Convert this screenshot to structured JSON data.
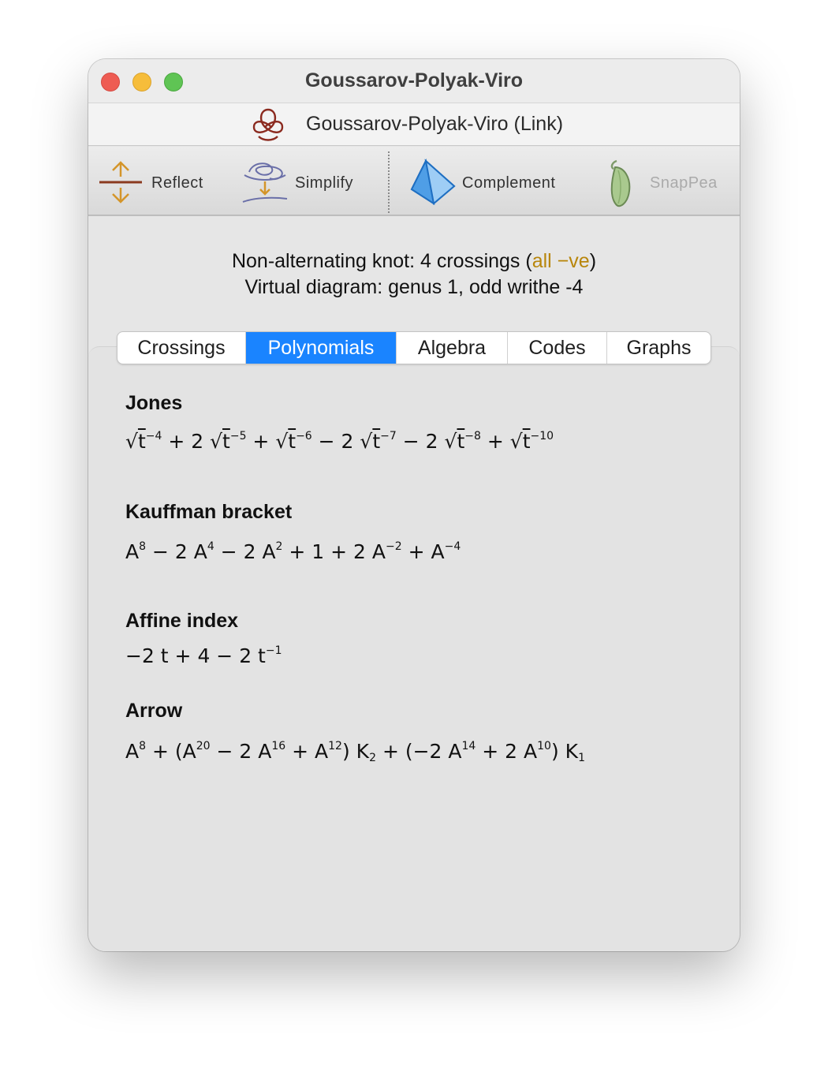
{
  "window": {
    "title": "Goussarov-Polyak-Viro",
    "document_title": "Goussarov-Polyak-Viro (Link)"
  },
  "toolbar": {
    "reflect_label": "Reflect",
    "simplify_label": "Simplify",
    "complement_label": "Complement",
    "snappea_label": "SnapPea"
  },
  "summary": {
    "line1_prefix": "Non-alternating knot: 4 crossings (",
    "line1_highlight": "all −ve",
    "line1_suffix": ")",
    "line2": "Virtual diagram: genus 1, odd writhe -4",
    "highlight_color": "#b8860b"
  },
  "tabs": [
    {
      "label": "Crossings",
      "active": false
    },
    {
      "label": "Polynomials",
      "active": true
    },
    {
      "label": "Algebra",
      "active": false
    },
    {
      "label": "Codes",
      "active": false
    },
    {
      "label": "Graphs",
      "active": false
    }
  ],
  "accent_color": "#1a84ff",
  "polynomials": {
    "jones": {
      "title": "Jones",
      "terms": [
        {
          "coef": "",
          "sign": "",
          "exp": "−4"
        },
        {
          "coef": "2",
          "sign": "+",
          "exp": "−5"
        },
        {
          "coef": "",
          "sign": "+",
          "exp": "−6"
        },
        {
          "coef": "2",
          "sign": "−",
          "exp": "−7"
        },
        {
          "coef": "2",
          "sign": "−",
          "exp": "−8"
        },
        {
          "coef": "",
          "sign": "+",
          "exp": "−10"
        }
      ],
      "variable": "t"
    },
    "kauffman": {
      "title": "Kauffman bracket"
    },
    "affine": {
      "title": "Affine index"
    },
    "arrow": {
      "title": "Arrow"
    }
  }
}
